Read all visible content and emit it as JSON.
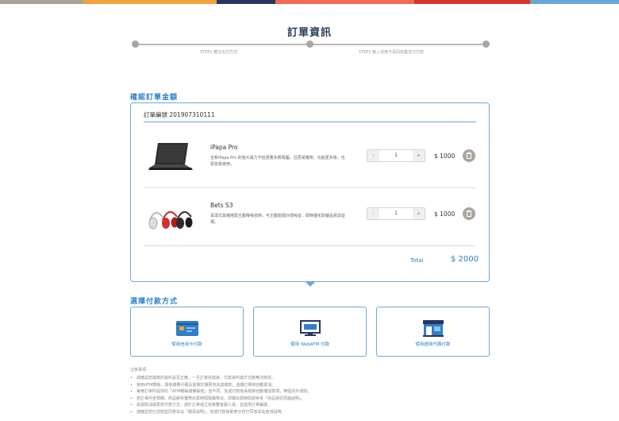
{
  "header": {
    "title": "訂單資訊",
    "colors": [
      "#a8a29b",
      "#f2a23a",
      "#26365f",
      "#f06a55",
      "#d6362f",
      "#6aa7d8"
    ]
  },
  "steps": [
    {
      "label": "STEP1 確在出付方式"
    },
    {
      "label": "STEP2 輸入信用卡資訊收集支付付款"
    }
  ],
  "order": {
    "section_title": "確認訂單金額",
    "order_number": "訂單編號 201907310111",
    "items": [
      {
        "name": "iPapa Pro",
        "description": "全新iPapa Pro 的強大威力不但更勝多數電腦，且更易攜帶。功能更多樣，也更容易使用。",
        "quantity": "1",
        "price": "$ 1000",
        "minus": "-",
        "plus": "+",
        "thumb": "tablet-with-keyboard"
      },
      {
        "name": "Bets S3",
        "description": "耳罩式耳機搭配主動降噪技術，可主動阻隔外部噪音，即時優化聆聽品質與音場。",
        "quantity": "1",
        "price": "$ 1000",
        "minus": "-",
        "plus": "+",
        "thumb": "headphones"
      }
    ],
    "total_label": "Total",
    "total_value": "$ 2000"
  },
  "payment": {
    "section_title": "選擇付款方式",
    "methods": [
      {
        "label": "使用信用卡付款",
        "icon": "credit-card-icon"
      },
      {
        "label": "使用 WebATM 付款",
        "icon": "webatm-icon"
      },
      {
        "label": "使用超商代碼付款",
        "icon": "convenience-store-icon"
      }
    ]
  },
  "notes": {
    "title": "注意事項",
    "items": [
      "請確認您填寫的資料是否正確，一旦訂單完成後，付款資料或方式將無法修改。",
      "使用ATM轉帳，請依繳費代碼及金額於期限內完成繳款，逾期訂單將自動取消。",
      "每筆訂單所提供的「ATM轉帳繳費帳號」皆不同，完成付款後系統將自動確認款項，無需另外通知。",
      "若訂單內含預購，商品將依實際出貨時間陸續寄出，詳細出貨時間請參考「商品資訊頁面說明」。",
      "如需取消或更改付款方式，請於訂單成立後聯繫客服人員，並提供訂單編號。",
      "請確認您已詳閱並同意本站「購買說明」，完成付款後即表示您已同意本站各項說明。"
    ]
  }
}
